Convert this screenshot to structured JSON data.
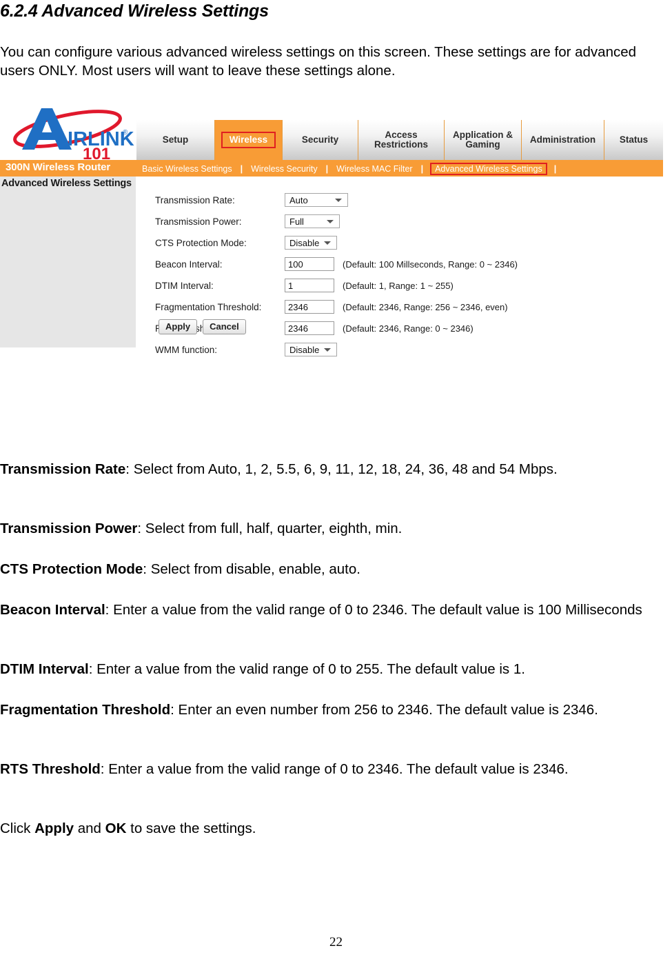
{
  "document": {
    "heading": "6.2.4 Advanced Wireless Settings",
    "intro": "You can configure various advanced wireless settings on this screen.  These settings are for advanced users ONLY.  Most users will want to leave these settings alone.",
    "page_number": "22"
  },
  "router_ui": {
    "brand": {
      "logo_text_air": "A",
      "logo_text_irlink": "IRLINK",
      "logo_registered": "®",
      "logo_101": "101",
      "product_name": "300N Wireless Router"
    },
    "top_nav": {
      "items": [
        {
          "label": "Setup",
          "active": false
        },
        {
          "label": "Wireless",
          "active": true
        },
        {
          "label": "Security",
          "active": false
        },
        {
          "label": "Access Restrictions",
          "active": false
        },
        {
          "label": "Application & Gaming",
          "active": false
        },
        {
          "label": "Administration",
          "active": false
        },
        {
          "label": "Status",
          "active": false
        }
      ]
    },
    "sub_nav": {
      "items": [
        {
          "label": "Basic Wireless Settings",
          "active": false
        },
        {
          "label": "Wireless Security",
          "active": false
        },
        {
          "label": "Wireless MAC Filter",
          "active": false
        },
        {
          "label": "Advanced Wireless Settings",
          "active": true
        }
      ],
      "separator": "|"
    },
    "side_panel": {
      "title": "Advanced Wireless Settings"
    },
    "form": {
      "fields": [
        {
          "label": "Transmission Rate:",
          "type": "select",
          "value": "Auto",
          "hint": ""
        },
        {
          "label": "Transmission Power:",
          "type": "select",
          "value": "Full",
          "hint": ""
        },
        {
          "label": "CTS Protection Mode:",
          "type": "select",
          "value": "Disable",
          "hint": ""
        },
        {
          "label": "Beacon Interval:",
          "type": "text",
          "value": "100",
          "hint": "(Default: 100 Millseconds, Range: 0 ~ 2346)"
        },
        {
          "label": "DTIM Interval:",
          "type": "text",
          "value": "1",
          "hint": "(Default: 1, Range: 1 ~ 255)"
        },
        {
          "label": "Fragmentation Threshold:",
          "type": "text",
          "value": "2346",
          "hint": "(Default: 2346, Range: 256 ~ 2346, even)"
        },
        {
          "label": "RTS Threshold:",
          "type": "text",
          "value": "2346",
          "hint": "(Default: 2346, Range: 0 ~ 2346)"
        },
        {
          "label": "WMM function:",
          "type": "select",
          "value": "Disable",
          "hint": ""
        }
      ],
      "apply_label": "Apply",
      "cancel_label": "Cancel"
    },
    "colors": {
      "orange": "#f89c36",
      "highlight_red": "#e02020",
      "panel_gray": "#e6e6e6",
      "logo_blue": "#1f6fc4",
      "logo_red": "#e0182c"
    }
  },
  "descriptions": [
    {
      "term": "Transmission Rate",
      "text": ": Select from Auto, 1, 2, 5.5, 6, 9, 11, 12, 18, 24, 36, 48 and 54 Mbps."
    },
    {
      "term": "Transmission Power",
      "text": ": Select from full, half, quarter, eighth, min."
    },
    {
      "term": "CTS Protection Mode",
      "text": ": Select from disable, enable, auto."
    },
    {
      "term": "Beacon Interval",
      "text": ": Enter a value from the valid range of 0 to 2346. The default value is 100 Milliseconds"
    },
    {
      "term": "DTIM Interval",
      "text": ": Enter a value from the valid range of 0 to 255. The default value is 1."
    },
    {
      "term": "Fragmentation Threshold",
      "text": ": Enter an even number from 256 to 2346. The default value is 2346."
    },
    {
      "term": "RTS Threshold",
      "text": ": Enter a value from the valid range of 0 to 2346. The default value is 2346."
    }
  ],
  "closing": {
    "prefix": "Click ",
    "bold1": "Apply",
    "mid": " and ",
    "bold2": "OK",
    "suffix": " to save the settings."
  }
}
